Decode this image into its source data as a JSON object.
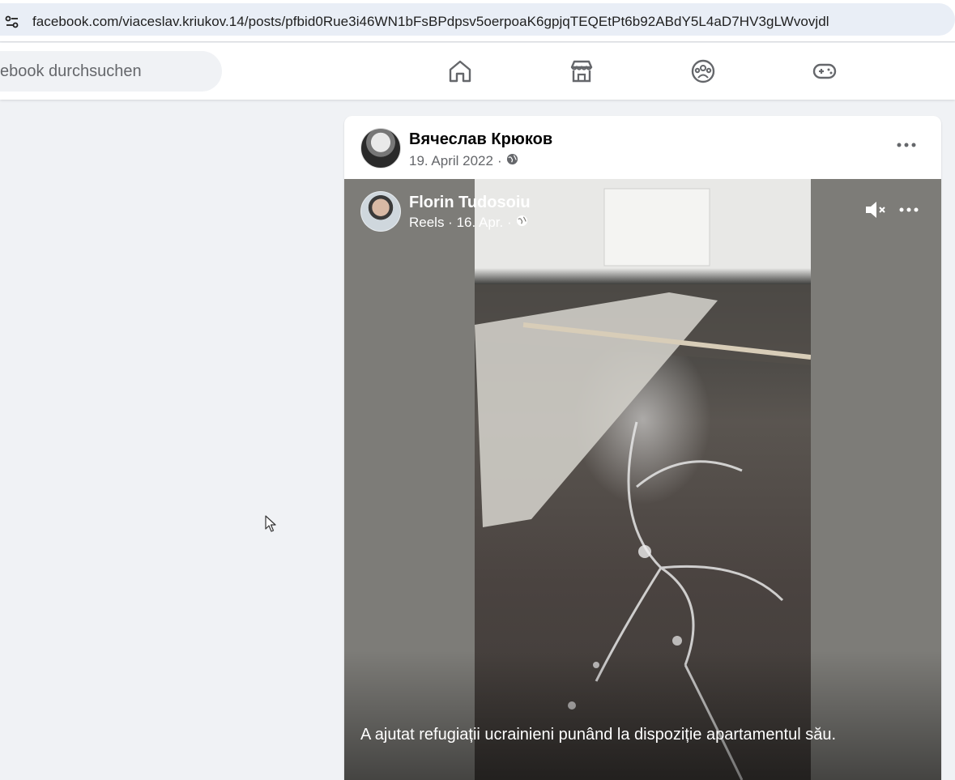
{
  "browser": {
    "url": "facebook.com/viaceslav.kriukov.14/posts/pfbid0Rue3i46WN1bFsBPdpsv5oerpoaK6gpjqTEQEtPt6b92ABdY5L4aD7HV3gLWvovjdl",
    "site_info_icon": "tune-icon"
  },
  "nav": {
    "search_placeholder": "ebook durchsuchen",
    "icons": [
      "home-icon",
      "marketplace-icon",
      "groups-icon",
      "gaming-icon"
    ]
  },
  "post": {
    "author": "Вячеслав Крюков",
    "date": "19. April 2022",
    "separator": "·",
    "privacy_icon": "globe-icon",
    "more_icon": "more-icon"
  },
  "reel": {
    "author": "Florin Tudosoiu",
    "meta": "Reels · 16. Apr. ·",
    "privacy_icon": "globe-icon",
    "mute_icon": "muted-speaker-icon",
    "more_icon": "more-icon",
    "caption": "A ajutat refugiații ucrainieni punând la dispoziție apartamentul său."
  },
  "colors": {
    "page_bg": "#f0f2f5",
    "text_secondary": "#65676b",
    "nav_icon": "#65676b"
  }
}
